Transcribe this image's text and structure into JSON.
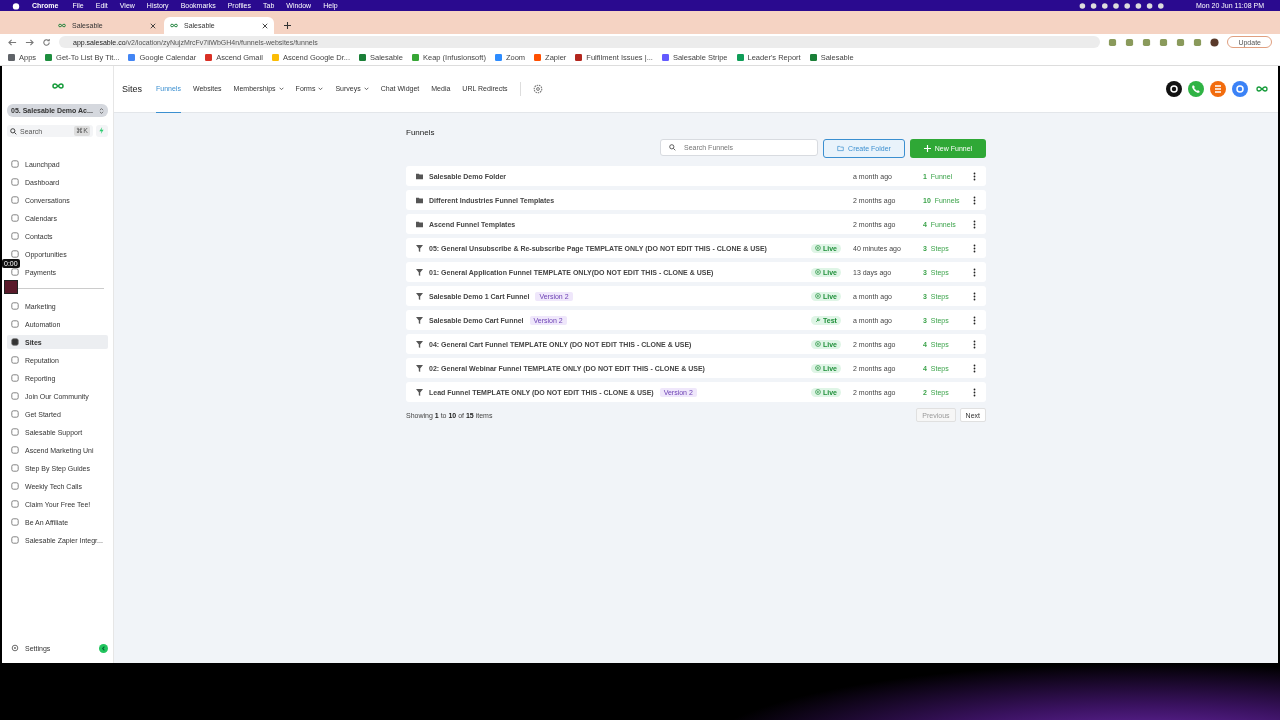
{
  "menubar": {
    "app": "Chrome",
    "menus": [
      "File",
      "Edit",
      "View",
      "History",
      "Bookmarks",
      "Profiles",
      "Tab",
      "Window",
      "Help"
    ],
    "clock": "Mon 20 Jun  11:08 PM"
  },
  "browser": {
    "tabs": [
      {
        "title": "Salesable",
        "selected": false
      },
      {
        "title": "Salesable",
        "selected": true
      }
    ],
    "url_host": "app.salesable.co",
    "url_path": "/v2/location/zyNujzMrcFv7iiWbGH4n/funnels-websites/funnels",
    "update_button": "Update",
    "bookmarks": [
      {
        "title": "Apps",
        "color": "#5f6368"
      },
      {
        "title": "Get-To List By Tit...",
        "color": "#1e8e3e"
      },
      {
        "title": "Google Calendar",
        "color": "#4285f4"
      },
      {
        "title": "Ascend Gmail",
        "color": "#d93025"
      },
      {
        "title": "Ascend Google Dr...",
        "color": "#fbbc04"
      },
      {
        "title": "Salesable",
        "color": "#1a7f37"
      },
      {
        "title": "Keap (Infusionsoft)",
        "color": "#36a635"
      },
      {
        "title": "Zoom",
        "color": "#2d8cff"
      },
      {
        "title": "Zapier",
        "color": "#ff4f00"
      },
      {
        "title": "Fulfilment Issues |...",
        "color": "#b3261e"
      },
      {
        "title": "Salesable Stripe",
        "color": "#635bff"
      },
      {
        "title": "Leader's Report",
        "color": "#0f9d58"
      },
      {
        "title": "Salesable",
        "color": "#1a7f37"
      }
    ]
  },
  "recording_timer": "0:00",
  "sidebar": {
    "account": "05. Salesable Demo Ac...",
    "search": {
      "placeholder": "Search",
      "shortcut": "⌘K"
    },
    "groups": [
      [
        {
          "label": "Launchpad",
          "selected": false
        },
        {
          "label": "Dashboard",
          "selected": false
        },
        {
          "label": "Conversations",
          "selected": false
        },
        {
          "label": "Calendars",
          "selected": false
        },
        {
          "label": "Contacts",
          "selected": false
        },
        {
          "label": "Opportunities",
          "selected": false
        },
        {
          "label": "Payments",
          "selected": false
        }
      ],
      [
        {
          "label": "Marketing",
          "selected": false
        },
        {
          "label": "Automation",
          "selected": false
        },
        {
          "label": "Sites",
          "selected": true
        },
        {
          "label": "Reputation",
          "selected": false
        },
        {
          "label": "Reporting",
          "selected": false
        },
        {
          "label": "Join Our Community",
          "selected": false
        },
        {
          "label": "Get Started",
          "selected": false
        },
        {
          "label": "Salesable Support",
          "selected": false
        },
        {
          "label": "Ascend Marketing Uni",
          "selected": false
        },
        {
          "label": "Step By Step Guides",
          "selected": false
        },
        {
          "label": "Weekly Tech Calls",
          "selected": false
        },
        {
          "label": "Claim Your Free Tee!",
          "selected": false
        },
        {
          "label": "Be An Affiliate",
          "selected": false
        },
        {
          "label": "Salesable Zapier Integr...",
          "selected": false
        }
      ]
    ],
    "settings": "Settings"
  },
  "topnav": {
    "title": "Sites",
    "tabs": [
      {
        "label": "Funnels",
        "selected": true,
        "dropdown": false
      },
      {
        "label": "Websites",
        "selected": false,
        "dropdown": false
      },
      {
        "label": "Memberships",
        "selected": false,
        "dropdown": true
      },
      {
        "label": "Forms",
        "selected": false,
        "dropdown": true
      },
      {
        "label": "Surveys",
        "selected": false,
        "dropdown": true
      },
      {
        "label": "Chat Widget",
        "selected": false,
        "dropdown": false
      },
      {
        "label": "Media",
        "selected": false,
        "dropdown": false
      },
      {
        "label": "URL Redirects",
        "selected": false,
        "dropdown": false
      }
    ]
  },
  "content": {
    "title": "Funnels",
    "search": {
      "placeholder": "Search Funnels"
    },
    "create_folder": "Create Folder",
    "new_funnel": "New Funnel",
    "rows": [
      {
        "kind": "folder",
        "name": "Salesable Demo Folder",
        "time": "a month ago",
        "count": "1",
        "unit": "Funnel"
      },
      {
        "kind": "folder",
        "name": "Different Industries Funnel Templates",
        "time": "2 months ago",
        "count": "10",
        "unit": "Funnels"
      },
      {
        "kind": "folder",
        "name": "Ascend Funnel Templates",
        "time": "2 months ago",
        "count": "4",
        "unit": "Funnels"
      },
      {
        "kind": "funnel",
        "name": "05: General Unsubscribe & Re-subscribe Page TEMPLATE ONLY (DO NOT EDIT THIS - CLONE & USE)",
        "status": {
          "kind": "live",
          "label": "Live"
        },
        "time": "40 minutes ago",
        "count": "3",
        "unit": "Steps"
      },
      {
        "kind": "funnel",
        "name": "01: General Application Funnel TEMPLATE ONLY(DO NOT EDIT THIS - CLONE & USE)",
        "status": {
          "kind": "live",
          "label": "Live"
        },
        "time": "13 days ago",
        "count": "3",
        "unit": "Steps"
      },
      {
        "kind": "funnel",
        "name": "Salesable Demo 1 Cart Funnel",
        "badge": "Version 2",
        "status": {
          "kind": "live",
          "label": "Live"
        },
        "time": "a month ago",
        "count": "3",
        "unit": "Steps"
      },
      {
        "kind": "funnel",
        "name": "Salesable Demo Cart Funnel",
        "badge": "Version 2",
        "status": {
          "kind": "test",
          "label": "Test"
        },
        "time": "a month ago",
        "count": "3",
        "unit": "Steps"
      },
      {
        "kind": "funnel",
        "name": "04: General Cart Funnel TEMPLATE ONLY (DO NOT EDIT THIS - CLONE & USE)",
        "status": {
          "kind": "live",
          "label": "Live"
        },
        "time": "2 months ago",
        "count": "4",
        "unit": "Steps"
      },
      {
        "kind": "funnel",
        "name": "02: General Webinar Funnel TEMPLATE ONLY (DO NOT EDIT THIS - CLONE & USE)",
        "status": {
          "kind": "live",
          "label": "Live"
        },
        "time": "2 months ago",
        "count": "4",
        "unit": "Steps"
      },
      {
        "kind": "funnel",
        "name": "Lead Funnel TEMPLATE ONLY (DO NOT EDIT THIS - CLONE & USE)",
        "badge": "Version 2",
        "status": {
          "kind": "live",
          "label": "Live"
        },
        "time": "2 months ago",
        "count": "2",
        "unit": "Steps"
      }
    ],
    "pagination": {
      "summary": "Showing **1** to **10** of **15** items",
      "previous": "Previous",
      "next": "Next"
    }
  }
}
